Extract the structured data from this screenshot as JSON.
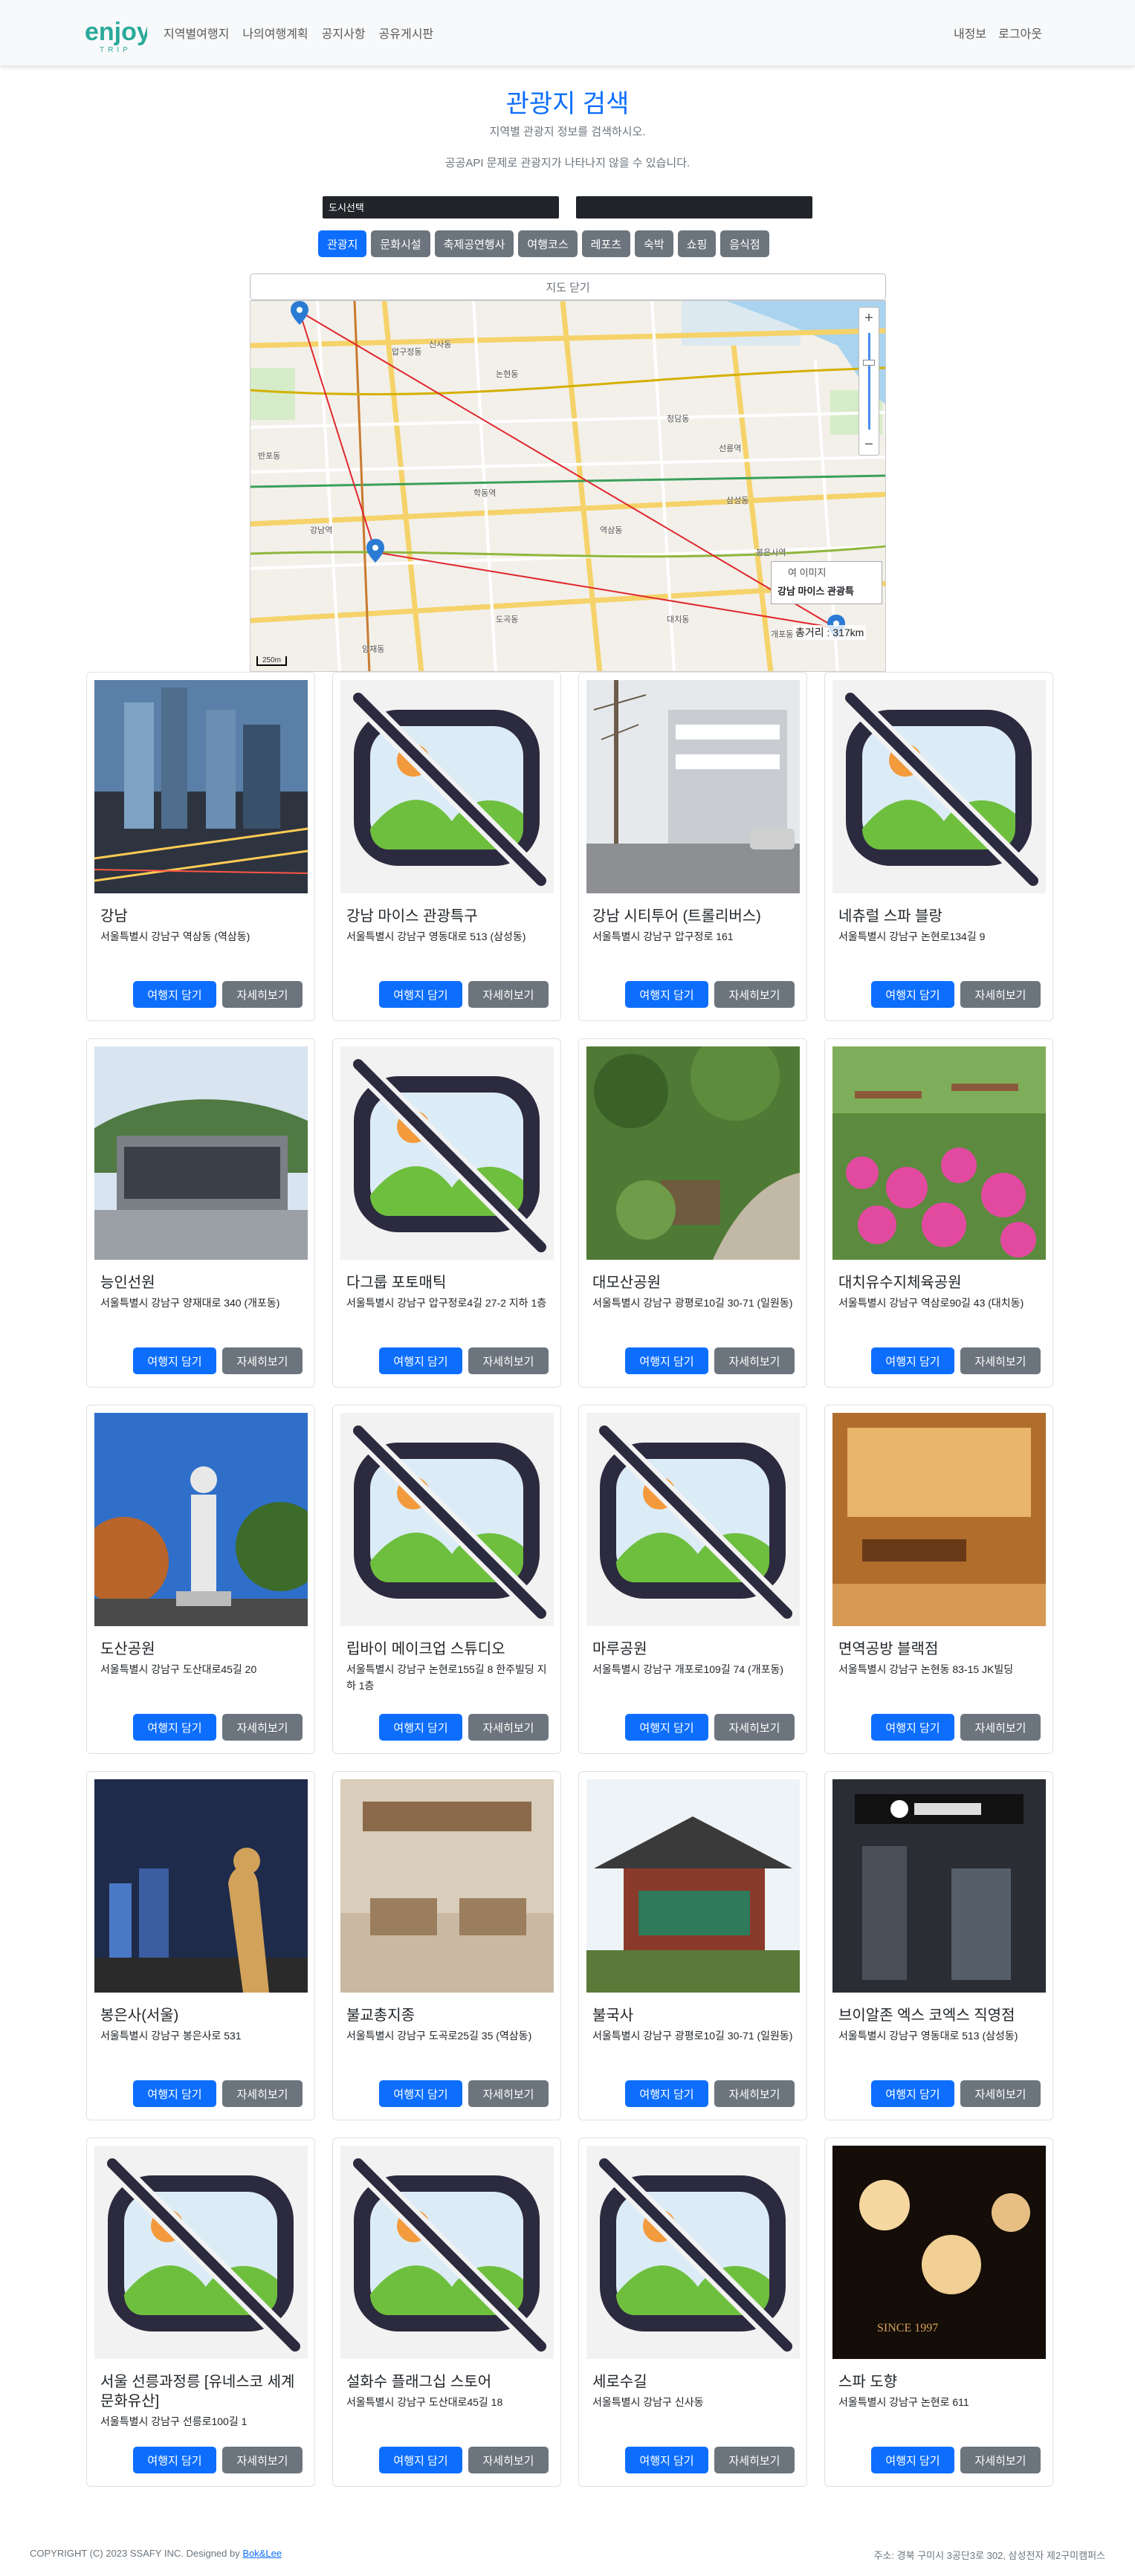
{
  "brand": {
    "logo_main": "enjoy",
    "logo_sub": "TRIP"
  },
  "nav": {
    "left": [
      "지역별여행지",
      "나의여행계획",
      "공지사항",
      "공유게시판"
    ],
    "right": [
      "내정보",
      "로그아웃"
    ]
  },
  "header": {
    "title": "관광지 검색",
    "subtitle": "지역별 관광지 정보를 검색하시오.",
    "notice": "공공API 문제로 관광지가 나타나지 않을 수 있습니다."
  },
  "filters": {
    "city_select": "도시선택",
    "district_select": ""
  },
  "categories": [
    {
      "label": "관광지",
      "active": true
    },
    {
      "label": "문화시설",
      "active": false
    },
    {
      "label": "축제공연행사",
      "active": false
    },
    {
      "label": "여행코스",
      "active": false
    },
    {
      "label": "레포츠",
      "active": false
    },
    {
      "label": "숙박",
      "active": false
    },
    {
      "label": "쇼핑",
      "active": false
    },
    {
      "label": "음식점",
      "active": false
    }
  ],
  "map": {
    "close_label": "지도 닫기",
    "popup_image_alt": "여 이미지",
    "popup_name": "강남 마이스 관광특",
    "distance_label": "총거리 : 317km",
    "scale_label": "250m",
    "labels": [
      "반포동",
      "압구정동",
      "신사동",
      "논현동",
      "청담동",
      "역삼동",
      "삼성동",
      "대치동",
      "도곡동",
      "개포동",
      "양재동",
      "선릉역",
      "강남역",
      "학동역",
      "봉은사역"
    ]
  },
  "buttons": {
    "add": "여행지 담기",
    "detail": "자세히보기"
  },
  "cards": [
    {
      "name": "강남",
      "address": "서울특별시 강남구 역삼동 (역삼동)",
      "image": "city-night"
    },
    {
      "name": "강남 마이스 관광특구",
      "address": "서울특별시 강남구 영동대로 513 (삼성동)",
      "image": "placeholder"
    },
    {
      "name": "강남 시티투어 (트롤리버스)",
      "address": "서울특별시 강남구 압구정로 161",
      "image": "street"
    },
    {
      "name": "네츄럴 스파 블랑",
      "address": "서울특별시 강남구 논현로134길 9",
      "image": "placeholder"
    },
    {
      "name": "능인선원",
      "address": "서울특별시 강남구 양재대로 340 (개포동)",
      "image": "building-hill"
    },
    {
      "name": "다그룹 포토매틱",
      "address": "서울특별시 강남구 압구정로4길 27-2 지하 1층",
      "image": "placeholder"
    },
    {
      "name": "대모산공원",
      "address": "서울특별시 강남구 광평로10길 30-71 (일원동)",
      "image": "garden"
    },
    {
      "name": "대치유수지체육공원",
      "address": "서울특별시 강남구 역삼로90길 43 (대치동)",
      "image": "flowers"
    },
    {
      "name": "도산공원",
      "address": "서울특별시 강남구 도산대로45길 20",
      "image": "statue"
    },
    {
      "name": "립바이 메이크업 스튜디오",
      "address": "서울특별시 강남구 논현로155길 8 한주빌딩 지하 1층",
      "image": "placeholder"
    },
    {
      "name": "마루공원",
      "address": "서울특별시 강남구 개포로109길 74 (개포동)",
      "image": "placeholder"
    },
    {
      "name": "면역공방 블랙점",
      "address": "서울특별시 강남구 논현동 83-15 JK빌딩",
      "image": "spa-room"
    },
    {
      "name": "봉은사(서울)",
      "address": "서울특별시 강남구 봉은사로 531",
      "image": "buddha-night"
    },
    {
      "name": "불교총지종",
      "address": "서울특별시 강남구 도곡로25길 35 (역삼동)",
      "image": "exhibit"
    },
    {
      "name": "불국사",
      "address": "서울특별시 강남구 광평로10길 30-71 (일원동)",
      "image": "temple"
    },
    {
      "name": "브이알존 엑스 코엑스 직영점",
      "address": "서울특별시 강남구 영동대로 513 (삼성동)",
      "image": "vr-zone"
    },
    {
      "name": "서울 선릉과정릉 [유네스코 세계문화유산]",
      "address": "서울특별시 강남구 선릉로100길 1",
      "image": "placeholder"
    },
    {
      "name": "설화수 플래그십 스토어",
      "address": "서울특별시 강남구 도산대로45길 18",
      "image": "placeholder"
    },
    {
      "name": "세로수길",
      "address": "서울특별시 강남구 신사동",
      "image": "placeholder"
    },
    {
      "name": "스파 도향",
      "address": "서울특별시 강남구 논현로 611",
      "image": "spa-dark"
    }
  ],
  "footer": {
    "copyright": "COPYRIGHT (C) 2023 SSAFY INC. Designed by ",
    "designer": "Bok&Lee",
    "address": "주소: 경북 구미시 3공단3로 302, 삼성전자 제2구미캠퍼스"
  }
}
